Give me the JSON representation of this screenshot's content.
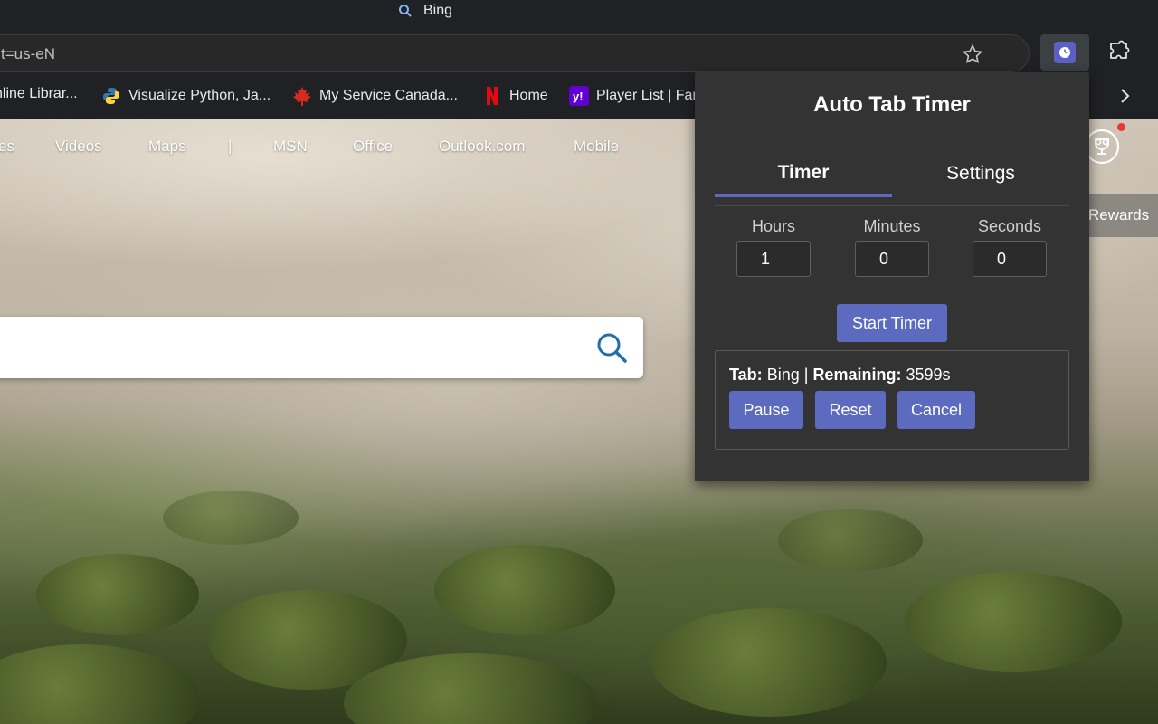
{
  "titlebar": {
    "tab_title": "Bing"
  },
  "toolbar": {
    "url_text": "t=us-eN"
  },
  "bookmarks": [
    {
      "label": "nline Librar...",
      "icon": "book-icon"
    },
    {
      "label": "Visualize Python, Ja...",
      "icon": "python-icon"
    },
    {
      "label": "My Service Canada...",
      "icon": "maple-leaf-icon"
    },
    {
      "label": "Home",
      "icon": "netflix-icon"
    },
    {
      "label": "Player List | Far",
      "icon": "yahoo-icon"
    }
  ],
  "bing_nav": [
    "es",
    "Videos",
    "Maps",
    "|",
    "MSN",
    "Office",
    "Outlook.com",
    "Mobile"
  ],
  "rewards": {
    "label": "Rewards"
  },
  "popup": {
    "title": "Auto Tab Timer",
    "tabs": {
      "timer": "Timer",
      "settings": "Settings"
    },
    "fields": {
      "hours_label": "Hours",
      "hours_value": "1",
      "minutes_label": "Minutes",
      "minutes_value": "0",
      "seconds_label": "Seconds",
      "seconds_value": "0"
    },
    "start_label": "Start Timer",
    "status": {
      "tab_label": "Tab:",
      "tab_value": "Bing",
      "separator": "|",
      "remaining_label": "Remaining:",
      "remaining_value": "3599s"
    },
    "actions": {
      "pause": "Pause",
      "reset": "Reset",
      "cancel": "Cancel"
    }
  },
  "colors": {
    "accent": "#5c6bc0",
    "popup_bg": "#333333",
    "chrome_bg": "#202124"
  }
}
